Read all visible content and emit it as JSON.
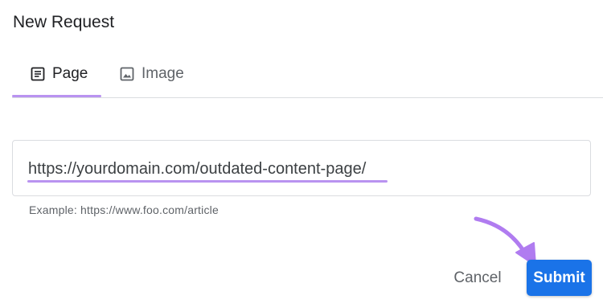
{
  "dialog": {
    "title": "New Request"
  },
  "tabs": [
    {
      "label": "Page",
      "icon": "article-icon",
      "selected": true
    },
    {
      "label": "Image",
      "icon": "image-icon",
      "selected": false
    }
  ],
  "url_field": {
    "value": "https://yourdomain.com/outdated-content-page/",
    "helper": "Example: https://www.foo.com/article"
  },
  "actions": {
    "cancel_label": "Cancel",
    "submit_label": "Submit"
  },
  "colors": {
    "accent_purple": "#b993f0",
    "submit_blue": "#1a73e8",
    "annotation_arrow": "#b07cf0"
  }
}
